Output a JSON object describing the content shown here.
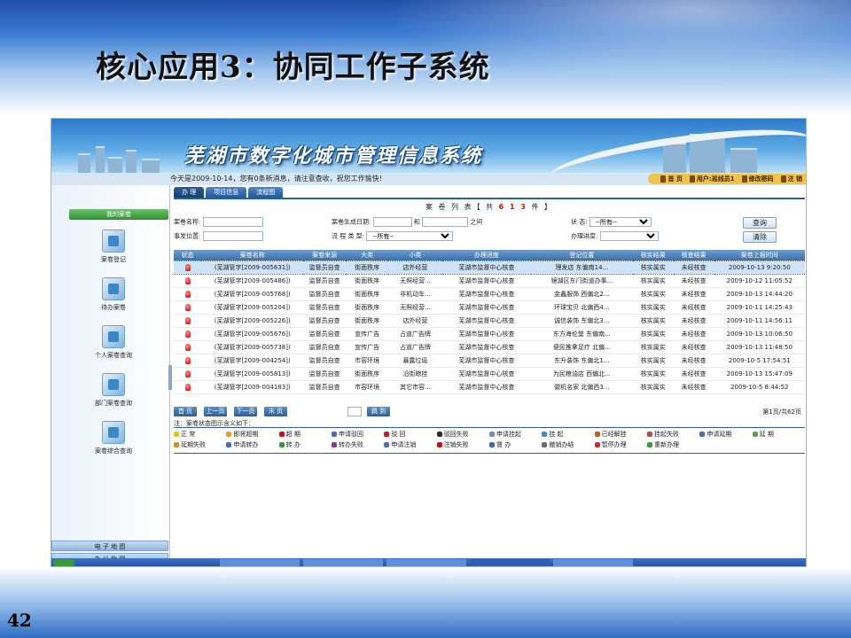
{
  "slide": {
    "title": "核心应用3：协同工作子系统",
    "page_number": "42"
  },
  "app": {
    "banner_title": "芜湖市数字化城市管理信息系统",
    "notice": "今天是2009-10-14，您有0条新消息，请注意查收，祝您工作愉快！",
    "top_nav": [
      "首 页",
      "用户:巡线员1",
      "修改密码",
      "注 销"
    ],
    "tabs": [
      "办 理",
      "项目信息",
      "流程图"
    ]
  },
  "sidebar": {
    "header": "我的案卷",
    "items": [
      "案卷登记",
      "待办案卷",
      "个人案卷查询",
      "部门案卷查询",
      "案卷综合查询"
    ],
    "footer": [
      "电 子 地 图",
      "办 公 助 理"
    ]
  },
  "list": {
    "title_prefix": "案 卷 列 表【 共",
    "count": "6 1 3",
    "title_suffix": "件 】"
  },
  "search": {
    "created_date_label": "案卷生成日期:",
    "and_label": "和",
    "between_label": "之间",
    "status_label": "状    态:",
    "status_value": "--所有--",
    "case_name_label": "案卷名称:",
    "location_label": "事发位置:",
    "flow_type_label": "流 程 类 型:",
    "flow_type_value": "--所有--",
    "progress_label": "办理进度:",
    "progress_value": "",
    "query_button": "查询",
    "clear_button": "清除"
  },
  "table": {
    "columns": [
      "状态",
      "案卷名称",
      "案卷来源",
      "大类",
      "小类",
      "办理进度",
      "登记位置",
      "核实结果",
      "核查结果",
      "案卷上报时间"
    ],
    "rows": [
      [
        "(芜湖管字[2009-005631])",
        "监督员自查",
        "街面秩序",
        "店外经营",
        "芜湖市监督中心核查",
        "理发店 东偏南14...",
        "核实属实",
        "未经核查",
        "2009-10-13 9:20:50"
      ],
      [
        "(芜湖管字[2009-005486])",
        "监督员自查",
        "街面秩序",
        "无照经营...",
        "芜湖市监督中心核查",
        "镜湖区东门街道办事...",
        "核实属实",
        "未经核查",
        "2009-10-12 11:05:52"
      ],
      [
        "(芜湖管字[2009-005768])",
        "监督员自查",
        "街面秩序",
        "非机动车...",
        "芜湖市监督中心核查",
        "金鑫服饰 西偏北2...",
        "核实属实",
        "未经核查",
        "2009-10-13 14:44:20"
      ],
      [
        "(芜湖管字[2009-005204])",
        "监督员自查",
        "街面秩序",
        "无照经营...",
        "芜湖市监督中心核查",
        "环球宝贝 北偏西4...",
        "核实属实",
        "未经核查",
        "2009-10-11 14:25:43"
      ],
      [
        "(芜湖管字[2009-005226])",
        "监督员自查",
        "街面秩序",
        "店外经营",
        "芜湖市监督中心核查",
        "诚信装饰 东偏北3...",
        "核实属实",
        "未经核查",
        "2009-10-11 14:56:11"
      ],
      [
        "(芜湖管字[2009-005676])",
        "监督员自查",
        "宣传广告",
        "占道广告牌",
        "芜湖市监督中心核查",
        "东方海伦堡 东偏南...",
        "核实属实",
        "未经核查",
        "2009-10-13 10:06:50"
      ],
      [
        "(芜湖管字[2009-005738])",
        "监督员自查",
        "宣传广告",
        "占道广告牌",
        "芜湖市监督中心核查",
        "便民推拿足疗 北偏...",
        "核实属实",
        "未经核查",
        "2009-10-13 11:48:50"
      ],
      [
        "(芜湖管字[2009-004254])",
        "监督员自查",
        "市容环境",
        "暴露垃圾",
        "芜湖市监督中心核查",
        "东升装饰 东偏北1...",
        "核实属实",
        "未经核查",
        "2009-10-5 17:54:51"
      ],
      [
        "(芜湖管字[2009-005813])",
        "监督员自查",
        "街面秩序",
        "沿街晾挂",
        "芜湖市监督中心核查",
        "为民粮油店 西偏北...",
        "核实属实",
        "未经核查",
        "2009-10-13 15:47:09"
      ],
      [
        "(芜湖管字[2009-004183])",
        "监督员自查",
        "市容环境",
        "其它市容...",
        "芜湖市监督中心核查",
        "徽机名家 北偏西3...",
        "核实属实",
        "未经核查",
        "2009-10-5 8:44:52"
      ]
    ]
  },
  "pager": {
    "buttons": [
      "首 页",
      "上一页",
      "下一页",
      "末 页",
      "跳 到"
    ],
    "info": "第1页/共62页"
  },
  "legend": {
    "note": "注：案卷状态图示含义如下：",
    "items": [
      {
        "label": "正  常",
        "color": "#e0c21a"
      },
      {
        "label": "即将超期",
        "color": "#f0a020"
      },
      {
        "label": "超   期",
        "color": "#d01010"
      },
      {
        "label": "申请驳回",
        "color": "#4a6fb0"
      },
      {
        "label": "驳   回",
        "color": "#c02020"
      },
      {
        "label": "驳回失败",
        "color": "#303030"
      },
      {
        "label": "申请挂起",
        "color": "#6a8fc0"
      },
      {
        "label": "挂   起",
        "color": "#4a88c8"
      },
      {
        "label": "已经解挂",
        "color": "#c06020"
      },
      {
        "label": "挂起失败",
        "color": "#b05050"
      },
      {
        "label": "申请延期",
        "color": "#4a6fb0"
      },
      {
        "label": "延   期",
        "color": "#5aa050"
      },
      {
        "label": "延期失败",
        "color": "#d09030"
      },
      {
        "label": "申请转办",
        "color": "#4a6fb0"
      },
      {
        "label": "转   办",
        "color": "#3a9a3a"
      },
      {
        "label": "转办失败",
        "color": "#8a3a8a"
      },
      {
        "label": "申请注销",
        "color": "#4a6fb0"
      },
      {
        "label": "注销失败",
        "color": "#d01010"
      },
      {
        "label": "督   办",
        "color": "#3a6ac0"
      },
      {
        "label": "撤销办结",
        "color": "#6a6a6a"
      },
      {
        "label": "暂停办理",
        "color": "#c03030"
      },
      {
        "label": "重新办理",
        "color": "#3a9a3a"
      }
    ]
  }
}
